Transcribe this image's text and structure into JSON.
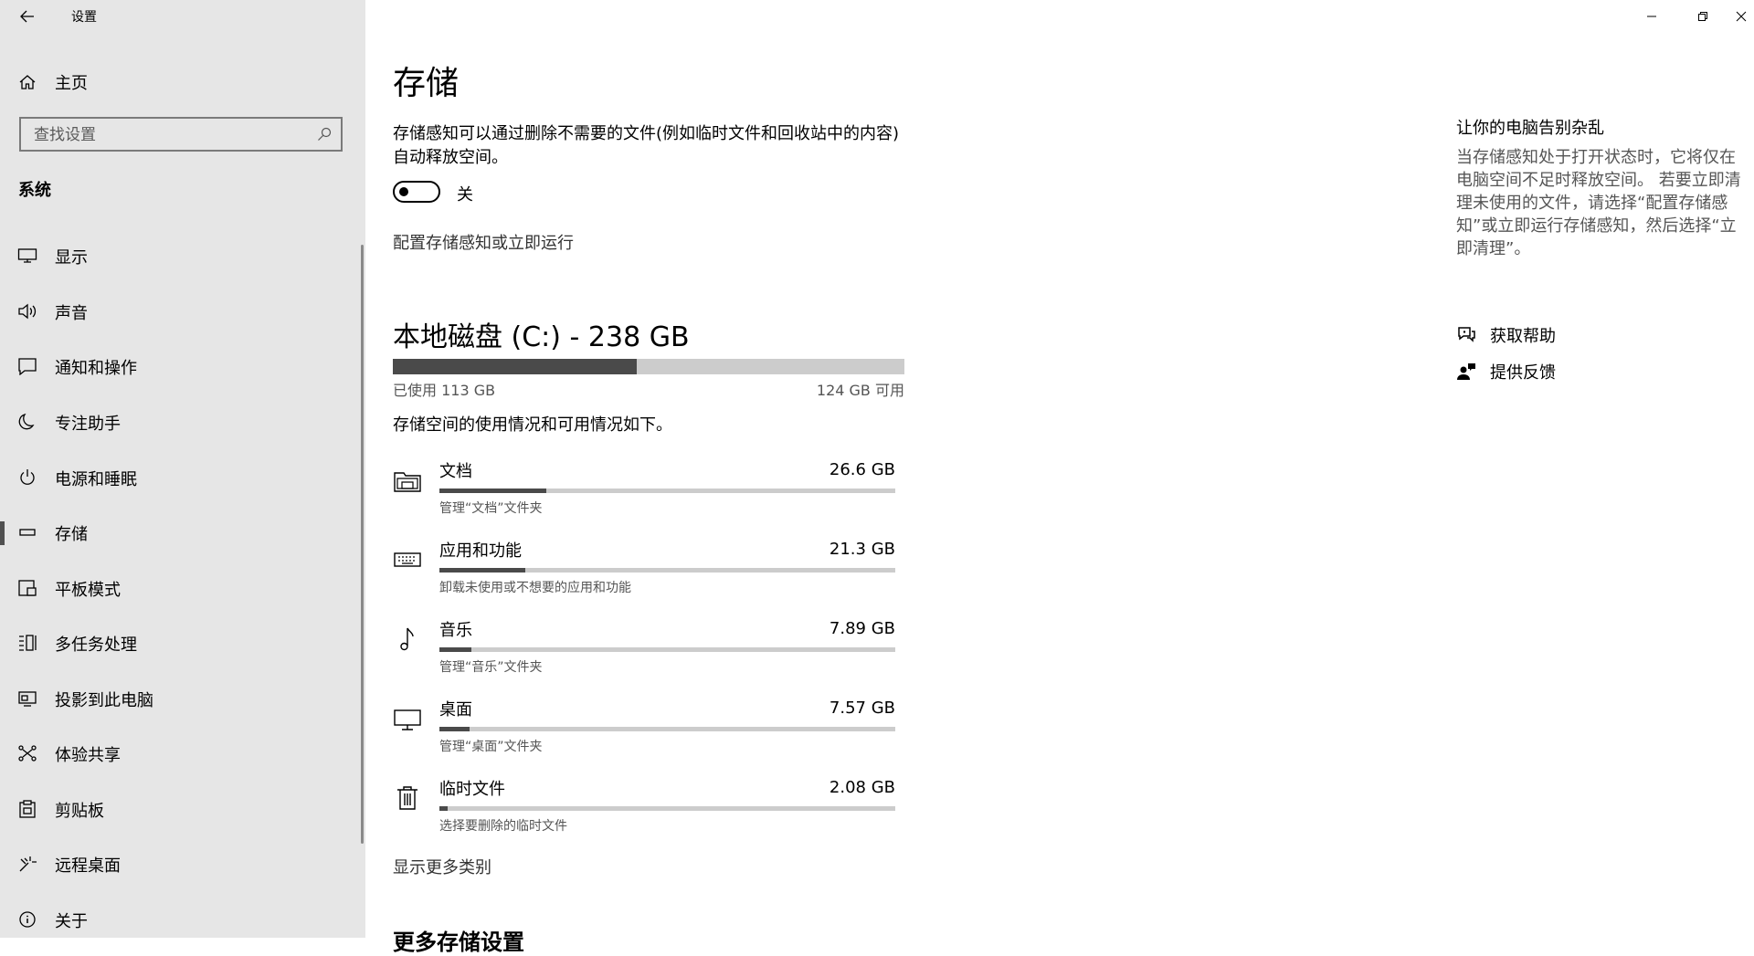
{
  "app": {
    "title": "设置",
    "back_icon": "back-arrow-icon"
  },
  "sidebar": {
    "home_label": "主页",
    "search_placeholder": "查找设置",
    "section_title": "系统",
    "items": [
      {
        "label": "显示",
        "icon": "display-icon"
      },
      {
        "label": "声音",
        "icon": "speaker-icon"
      },
      {
        "label": "通知和操作",
        "icon": "notification-icon"
      },
      {
        "label": "专注助手",
        "icon": "moon-icon"
      },
      {
        "label": "电源和睡眠",
        "icon": "power-icon"
      },
      {
        "label": "存储",
        "icon": "storage-icon",
        "active": true
      },
      {
        "label": "平板模式",
        "icon": "tablet-icon"
      },
      {
        "label": "多任务处理",
        "icon": "multitask-icon"
      },
      {
        "label": "投影到此电脑",
        "icon": "project-icon"
      },
      {
        "label": "体验共享",
        "icon": "share-icon"
      },
      {
        "label": "剪贴板",
        "icon": "clipboard-icon"
      },
      {
        "label": "远程桌面",
        "icon": "remote-icon"
      },
      {
        "label": "关于",
        "icon": "info-icon"
      }
    ]
  },
  "window": {
    "minimize": "minimize-icon",
    "restore": "restore-icon",
    "close": "close-icon"
  },
  "main": {
    "title": "存储",
    "storage_sense_desc": "存储感知可以通过删除不需要的文件(例如临时文件和回收站中的内容)自动释放空间。",
    "toggle_state": "关",
    "toggle_on": false,
    "configure_link": "配置存储感知或立即运行",
    "disk_title": "本地磁盘 (C:) - 238 GB",
    "disk_used_fraction": 0.477,
    "used_label": "已使用 113 GB",
    "free_label": "124 GB 可用",
    "usage_desc": "存储空间的使用情况和可用情况如下。",
    "categories": [
      {
        "name": "文档",
        "size": "26.6 GB",
        "sub": "管理“文档”文件夹",
        "fraction": 0.235,
        "icon": "folder-icon"
      },
      {
        "name": "应用和功能",
        "size": "21.3 GB",
        "sub": "卸载未使用或不想要的应用和功能",
        "fraction": 0.188,
        "icon": "keyboard-icon"
      },
      {
        "name": "音乐",
        "size": "7.89 GB",
        "sub": "管理“音乐”文件夹",
        "fraction": 0.07,
        "icon": "music-note-icon"
      },
      {
        "name": "桌面",
        "size": "7.57 GB",
        "sub": "管理“桌面”文件夹",
        "fraction": 0.067,
        "icon": "monitor-icon"
      },
      {
        "name": "临时文件",
        "size": "2.08 GB",
        "sub": "选择要删除的临时文件",
        "fraction": 0.018,
        "icon": "trash-icon"
      }
    ],
    "show_more_link": "显示更多类别",
    "more_settings_title": "更多存储设置"
  },
  "aside": {
    "title": "让你的电脑告别杂乱",
    "text": "当存储感知处于打开状态时，它将仅在电脑空间不足时释放空间。 若要立即清理未使用的文件，请选择“配置存储感知”或立即运行存储感知，然后选择“立即清理”。",
    "help_label": "获取帮助",
    "feedback_label": "提供反馈"
  },
  "colors": {
    "sidebar_bg": "#e6e6e6",
    "bar_fill": "#4a4a4a",
    "bar_track": "#cccccc"
  }
}
